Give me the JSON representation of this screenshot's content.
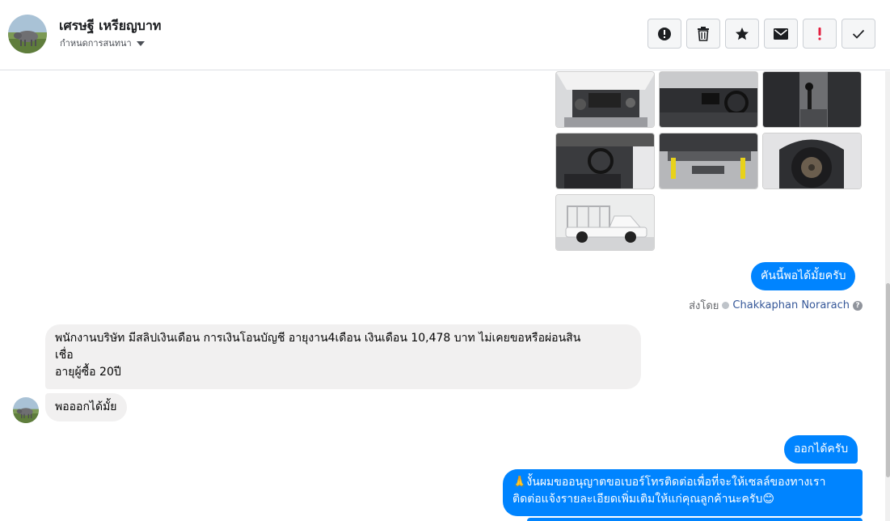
{
  "header": {
    "contact_name": "เศรษฐี เหรียญบาท",
    "conversation_label": "กำหนดการสนทนา"
  },
  "toolbar": {
    "buttons": [
      {
        "name": "spam",
        "icon": "alert-circle-icon"
      },
      {
        "name": "delete",
        "icon": "trash-icon"
      },
      {
        "name": "star",
        "icon": "star-icon"
      },
      {
        "name": "unread",
        "icon": "envelope-icon"
      },
      {
        "name": "important",
        "icon": "exclamation-icon"
      },
      {
        "name": "done",
        "icon": "check-icon"
      }
    ]
  },
  "colors": {
    "outgoing_bubble": "#0084ff",
    "incoming_bubble": "#f1f0f0",
    "agent_link": "#365899",
    "important_icon": "#e41e3f"
  },
  "messages": {
    "outgoing_1": "คันนี้พอได้มั้ยครับ",
    "sent_by_prefix": "ส่งโดย",
    "sent_by_agent": "Chakkaphan Norarach",
    "incoming_1_line1": "พนักงานบริษัท มีสลิปเงินเดือน การเงินโอนบัญชี อายุงาน4เดือน เงินเดือน 10,478 บาท ไม่เคยขอหรือผ่อนสิน",
    "incoming_1_line2": "เชื่อ",
    "incoming_1_line3": "อายุผู้ซื้อ 20ปี",
    "incoming_2": "พอออกได้มั้ย",
    "outgoing_2": "ออกได้ครับ",
    "outgoing_3_line1": "🙏งั้นผมขออนุญาตขอเบอร์โทรติดต่อเพื่อที่จะให้เซลล์ของทางเรา",
    "outgoing_3_line2": "ติดต่อแจ้งรายละเอียดเพิ่มเติมให้แก่คุณลูกค้านะครับ😊"
  }
}
